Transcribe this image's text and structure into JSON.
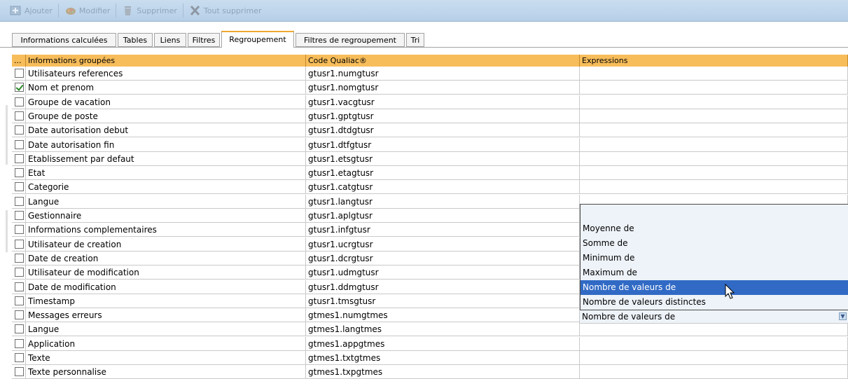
{
  "toolbar": {
    "add_label": "Ajouter",
    "modify_label": "Modifier",
    "delete_label": "Supprimer",
    "delete_all_label": "Tout supprimer"
  },
  "tabs": [
    {
      "label": "Informations calculées"
    },
    {
      "label": "Tables"
    },
    {
      "label": "Liens"
    },
    {
      "label": "Filtres"
    },
    {
      "label": "Regroupement"
    },
    {
      "label": "Filtres de regroupement"
    },
    {
      "label": "Tri"
    }
  ],
  "active_tab": "Regroupement",
  "grid": {
    "headers": {
      "select": "...",
      "info": "Informations groupées",
      "code": "Code Qualiac®",
      "expr": "Expressions"
    },
    "rows": [
      {
        "checked": false,
        "info": "Utilisateurs references",
        "code": "gtusr1.numgtusr",
        "expr": ""
      },
      {
        "checked": true,
        "info": "Nom et prenom",
        "code": "gtusr1.nomgtusr",
        "expr": ""
      },
      {
        "checked": false,
        "info": "Groupe de vacation",
        "code": "gtusr1.vacgtusr",
        "expr": ""
      },
      {
        "checked": false,
        "info": "Groupe de poste",
        "code": "gtusr1.gptgtusr",
        "expr": ""
      },
      {
        "checked": false,
        "info": "Date autorisation debut",
        "code": "gtusr1.dtdgtusr",
        "expr": ""
      },
      {
        "checked": false,
        "info": "Date autorisation fin",
        "code": "gtusr1.dtfgtusr",
        "expr": ""
      },
      {
        "checked": false,
        "info": "Etablissement par defaut",
        "code": "gtusr1.etsgtusr",
        "expr": ""
      },
      {
        "checked": false,
        "info": "Etat",
        "code": "gtusr1.etagtusr",
        "expr": ""
      },
      {
        "checked": false,
        "info": "Categorie",
        "code": "gtusr1.catgtusr",
        "expr": ""
      },
      {
        "checked": false,
        "info": "Langue",
        "code": "gtusr1.langtusr",
        "expr": ""
      },
      {
        "checked": false,
        "info": "Gestionnaire",
        "code": "gtusr1.aplgtusr",
        "expr": ""
      },
      {
        "checked": false,
        "info": "Informations complementaires",
        "code": "gtusr1.infgtusr",
        "expr": ""
      },
      {
        "checked": false,
        "info": "Utilisateur de creation",
        "code": "gtusr1.ucrgtusr",
        "expr": ""
      },
      {
        "checked": false,
        "info": "Date de creation",
        "code": "gtusr1.dcrgtusr",
        "expr": ""
      },
      {
        "checked": false,
        "info": "Utilisateur de modification",
        "code": "gtusr1.udmgtusr",
        "expr": ""
      },
      {
        "checked": false,
        "info": "Date de modification",
        "code": "gtusr1.ddmgtusr",
        "expr": ""
      },
      {
        "checked": false,
        "info": "Timestamp",
        "code": "gtusr1.tmsgtusr",
        "expr": ""
      },
      {
        "checked": false,
        "info": "Messages erreurs",
        "code": "gtmes1.numgtmes",
        "expr": ""
      },
      {
        "checked": false,
        "info": "Langue",
        "code": "gtmes1.langtmes",
        "expr": ""
      },
      {
        "checked": false,
        "info": "Application",
        "code": "gtmes1.appgtmes",
        "expr": ""
      },
      {
        "checked": false,
        "info": "Texte",
        "code": "gtmes1.txtgtmes",
        "expr": ""
      },
      {
        "checked": false,
        "info": "Texte personnalise",
        "code": "gtmes1.txpgtmes",
        "expr": ""
      }
    ]
  },
  "expression_dropdown": {
    "options": [
      "Moyenne de",
      "Somme de",
      "Minimum de",
      "Maximum de",
      "Nombre de valeurs de",
      "Nombre de valeurs distinctes"
    ],
    "highlighted": "Nombre de valeurs de",
    "selected_value": "Nombre de valeurs de"
  },
  "colors": {
    "toolbar_bg": "#c0d6ec",
    "header_bg": "#f7bd5a",
    "active_tab_accent": "#f0a830",
    "selection": "#316ac5"
  }
}
